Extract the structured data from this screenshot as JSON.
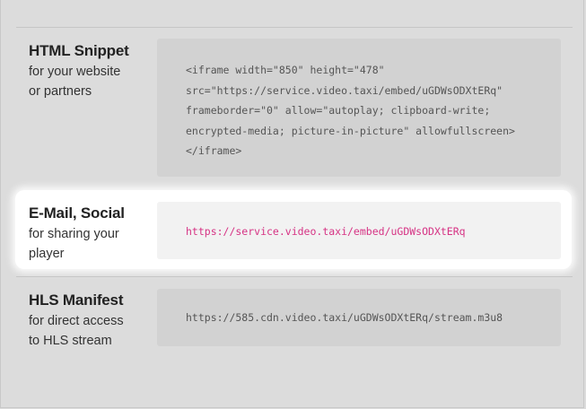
{
  "sections": [
    {
      "title": "HTML Snippet",
      "subtitle_lines": [
        "for your website",
        "or partners"
      ],
      "code_lines": [
        "<iframe width=\"850\" height=\"478\"",
        "src=\"https://service.video.taxi/embed/uGDWsODXtERq\"",
        "frameborder=\"0\" allow=\"autoplay; clipboard-write;",
        "encrypted-media; picture-in-picture\" allowfullscreen>",
        "</iframe>"
      ]
    },
    {
      "title": "E-Mail, Social",
      "subtitle_lines": [
        "for sharing your",
        "player"
      ],
      "code": "https://service.video.taxi/embed/uGDWsODXtERq"
    },
    {
      "title": "HLS Manifest",
      "subtitle_lines": [
        "for direct access",
        "to HLS stream"
      ],
      "code": "https://585.cdn.video.taxi/uGDWsODXtERq/stream.m3u8"
    }
  ],
  "colors": {
    "page_bg": "#dcdcdc",
    "code_bg": "#d2d2d2",
    "highlight_bg": "#ffffff",
    "link_color": "#d63384"
  }
}
